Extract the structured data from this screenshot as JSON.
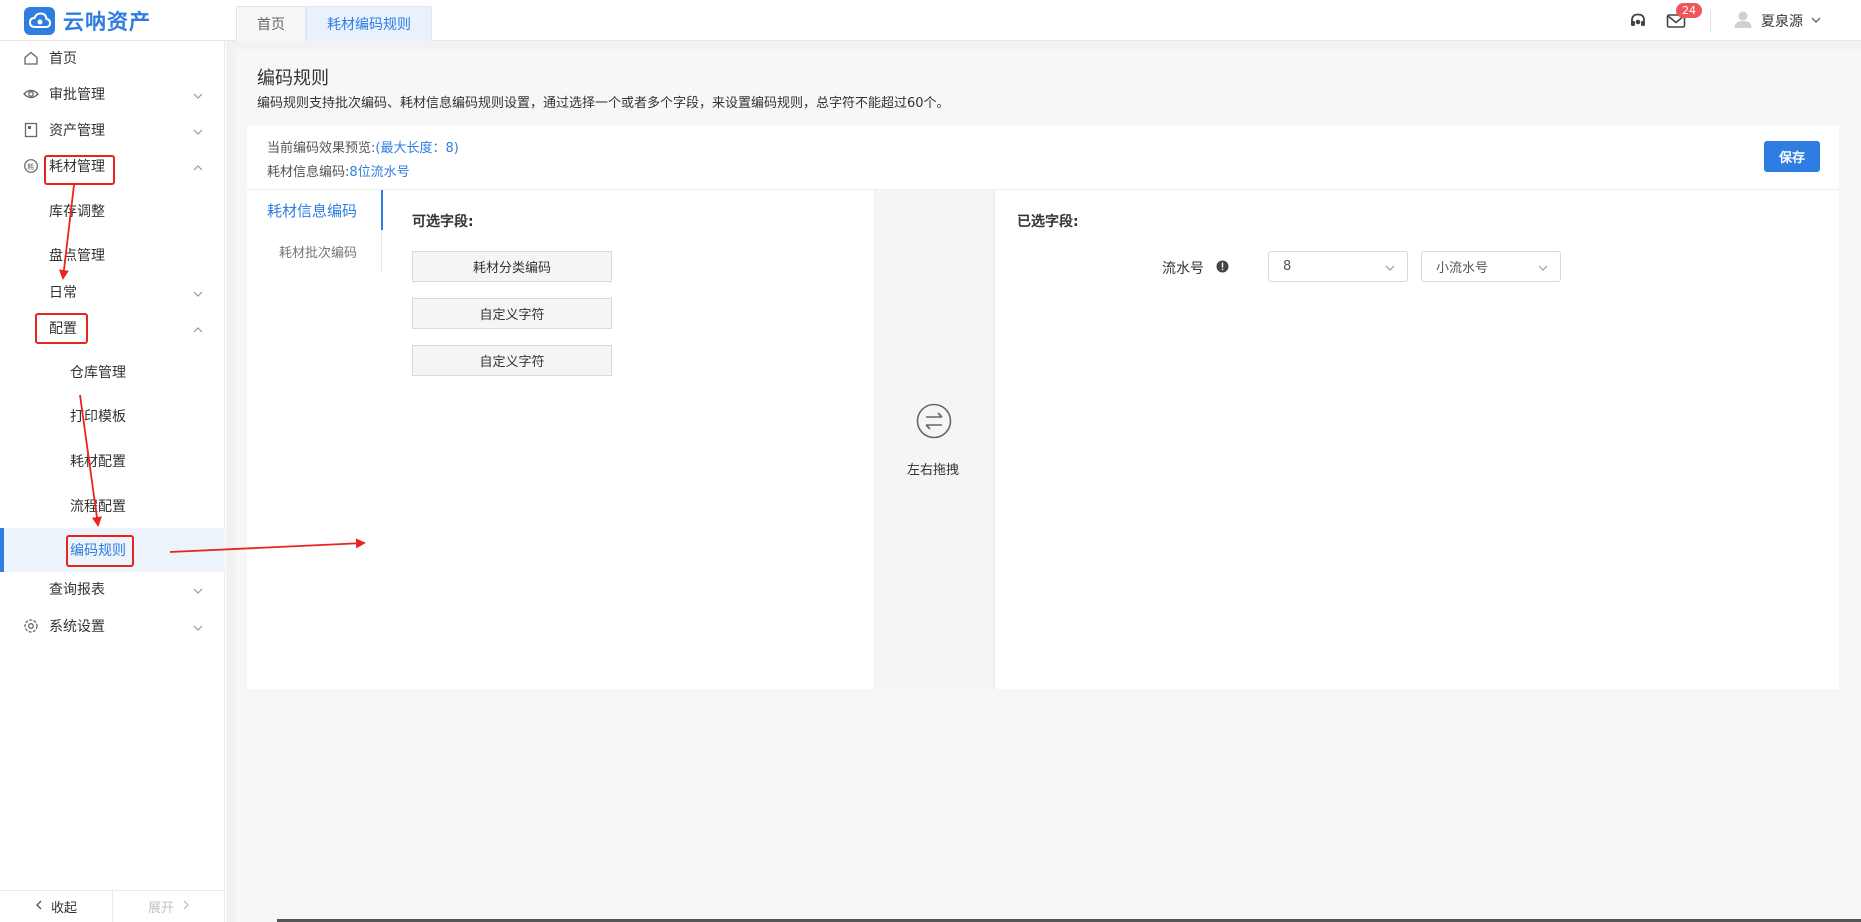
{
  "brand": {
    "name": "云呐资产",
    "color": "#2f7de1"
  },
  "tabs": [
    {
      "label": "首页",
      "active": false
    },
    {
      "label": "耗材编码规则",
      "active": true
    }
  ],
  "header": {
    "support_icon": "headset-icon",
    "mail_icon": "mail-icon",
    "mail_badge": "24",
    "user_name": "夏泉源"
  },
  "sidebar": {
    "items": [
      {
        "label": "首页",
        "icon": "home-icon"
      },
      {
        "label": "审批管理",
        "icon": "eye-icon"
      },
      {
        "label": "资产管理",
        "icon": "asset-icon"
      },
      {
        "label": "耗材管理",
        "icon": "consumable-icon"
      },
      {
        "label": "库存调整"
      },
      {
        "label": "盘点管理"
      },
      {
        "label": "日常"
      },
      {
        "label": "配置"
      },
      {
        "label": "仓库管理"
      },
      {
        "label": "打印模板"
      },
      {
        "label": "耗材配置"
      },
      {
        "label": "流程配置"
      },
      {
        "label": "编码规则",
        "selected": true
      },
      {
        "label": "查询报表"
      },
      {
        "label": "系统设置",
        "icon": "settings-icon"
      }
    ],
    "footer": {
      "collapse": "收起",
      "expand": "展开"
    }
  },
  "page": {
    "title": "编码规则",
    "description": "编码规则支持批次编码、耗材信息编码规则设置，通过选择一个或者多个字段，来设置编码规则，总字符不能超过60个。",
    "preview_label": "当前编码效果预览:",
    "preview_max": "(最大长度：8)",
    "info_label": "耗材信息编码:",
    "info_value": "8位流水号",
    "save_button": "保存",
    "vtabs": [
      {
        "label": "耗材信息编码",
        "active": true
      },
      {
        "label": "耗材批次编码",
        "active": false
      }
    ],
    "available": {
      "title": "可选字段:",
      "fields": [
        "耗材分类编码",
        "自定义字符",
        "自定义字符"
      ]
    },
    "drag_hint": "左右拖拽",
    "selected": {
      "title": "已选字段:",
      "field_label": "流水号",
      "length_value": "8",
      "type_value": "小流水号"
    }
  },
  "colors": {
    "accent": "#2f7de1",
    "annotation_red": "#e8241e",
    "badge_red": "#f2545b"
  }
}
